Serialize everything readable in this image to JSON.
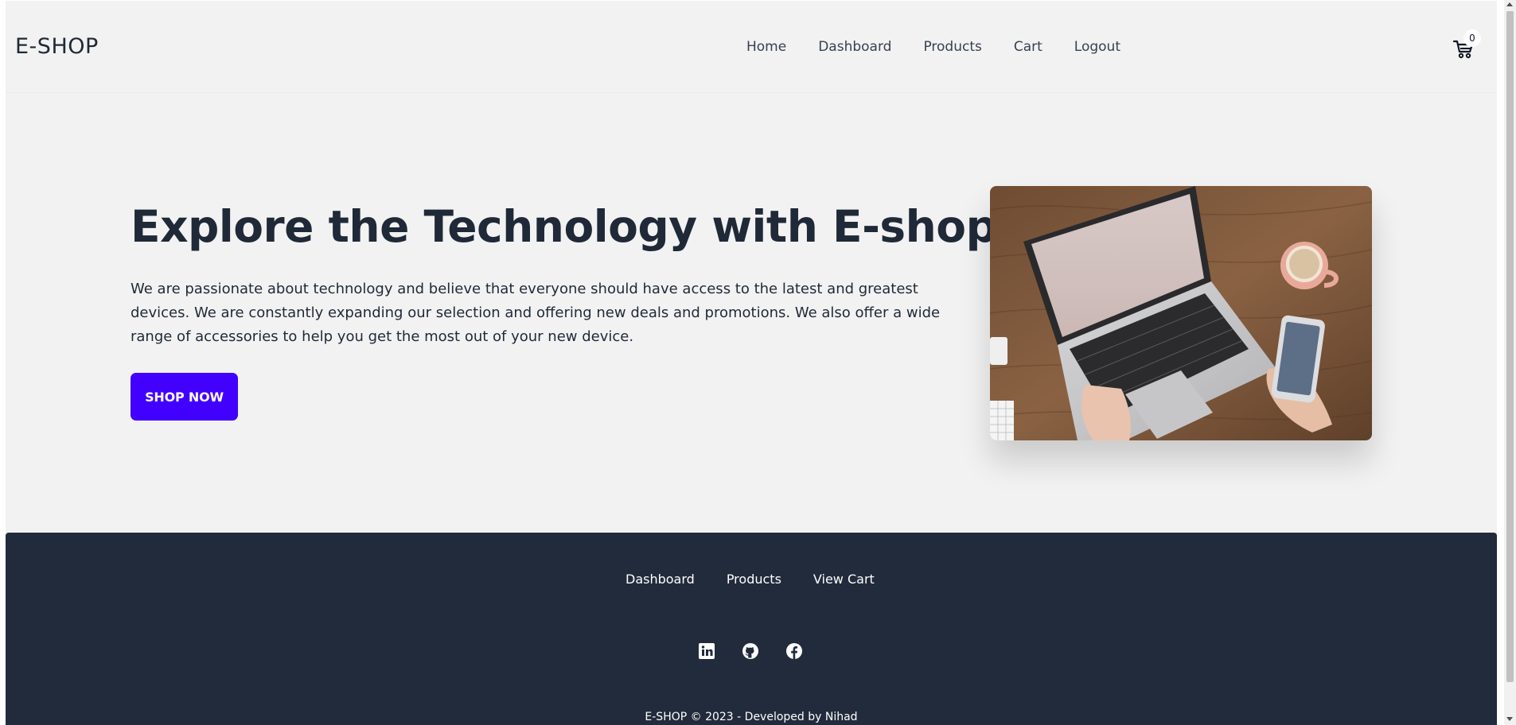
{
  "navbar": {
    "brand": "E-SHOP",
    "links": [
      {
        "label": "Home"
      },
      {
        "label": "Dashboard"
      },
      {
        "label": "Products"
      },
      {
        "label": "Cart"
      },
      {
        "label": "Logout"
      }
    ],
    "cart_count": "0",
    "cart_icon": "cart-icon"
  },
  "hero": {
    "title": "Explore the Technology with E-shop",
    "text": "We are passionate about technology and believe that everyone should have access to the latest and greatest devices. We are constantly expanding our selection and offering new deals and promotions. We also offer a wide range of accessories to help you get the most out of your new device.",
    "button_label": "SHOP NOW",
    "button_color": "#4200ff"
  },
  "footer": {
    "links": [
      {
        "label": "Dashboard"
      },
      {
        "label": "Products"
      },
      {
        "label": "View Cart"
      }
    ],
    "social_icons": [
      "linkedin-icon",
      "github-icon",
      "facebook-icon"
    ],
    "copyright": "E-SHOP © 2023 - Developed by Nihad",
    "background": "#222b3c"
  }
}
